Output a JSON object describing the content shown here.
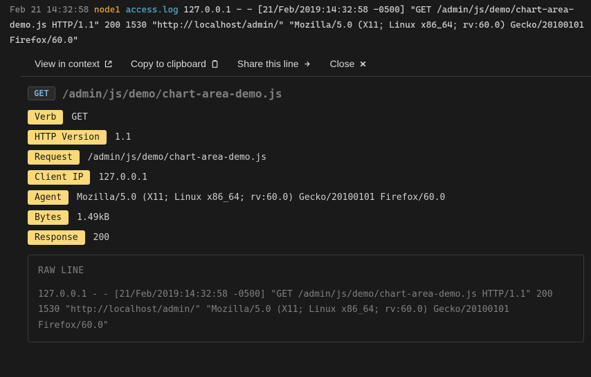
{
  "log_line": {
    "timestamp": "Feb 21 14:32:58",
    "node": "node1",
    "file": "access.log",
    "raw": "127.0.0.1 - - [21/Feb/2019:14:32:58 -0500] \"GET /admin/js/demo/chart-area-demo.js HTTP/1.1\" 200 1530 \"http://localhost/admin/\" \"Mozilla/5.0 (X11; Linux x86_64; rv:60.0) Gecko/20100101 Firefox/60.0\""
  },
  "actions": {
    "view_in_context": "View in context",
    "copy_to_clipboard": "Copy to clipboard",
    "share_this_line": "Share this line",
    "close": "Close"
  },
  "request": {
    "method": "GET",
    "path": "/admin/js/demo/chart-area-demo.js"
  },
  "fields": {
    "verb_label": "Verb",
    "verb_value": "GET",
    "http_version_label": "HTTP Version",
    "http_version_value": "1.1",
    "request_label": "Request",
    "request_value": "/admin/js/demo/chart-area-demo.js",
    "client_ip_label": "Client IP",
    "client_ip_value": "127.0.0.1",
    "agent_label": "Agent",
    "agent_value": "Mozilla/5.0 (X11; Linux x86_64; rv:60.0) Gecko/20100101 Firefox/60.0",
    "bytes_label": "Bytes",
    "bytes_value": "1.49kB",
    "response_label": "Response",
    "response_value": "200"
  },
  "raw_box": {
    "title": "RAW LINE",
    "content": "127.0.0.1 - - [21/Feb/2019:14:32:58 -0500] \"GET /admin/js/demo/chart-area-demo.js HTTP/1.1\" 200 1530 \"http://localhost/admin/\" \"Mozilla/5.0 (X11; Linux x86_64; rv:60.0) Gecko/20100101 Firefox/60.0\""
  }
}
